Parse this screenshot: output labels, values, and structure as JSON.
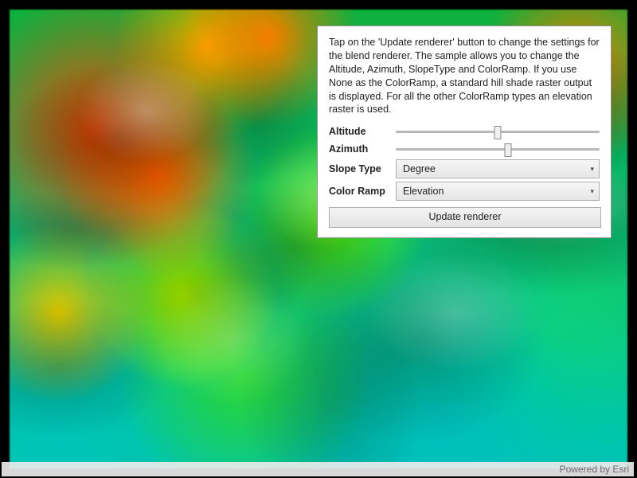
{
  "panel": {
    "instructions": "Tap on the 'Update renderer' button to change the settings for the blend renderer. The sample allows you to change the Altitude, Azimuth, SlopeType and ColorRamp. If you use None as the ColorRamp, a standard hill shade raster output is displayed. For all the other ColorRamp types an elevation raster is used.",
    "altitude_label": "Altitude",
    "azimuth_label": "Azimuth",
    "altitude_percent": 50,
    "azimuth_percent": 55,
    "slope_type_label": "Slope Type",
    "slope_type_value": "Degree",
    "color_ramp_label": "Color Ramp",
    "color_ramp_value": "Elevation",
    "update_button": "Update renderer"
  },
  "attribution": "Powered by Esri"
}
